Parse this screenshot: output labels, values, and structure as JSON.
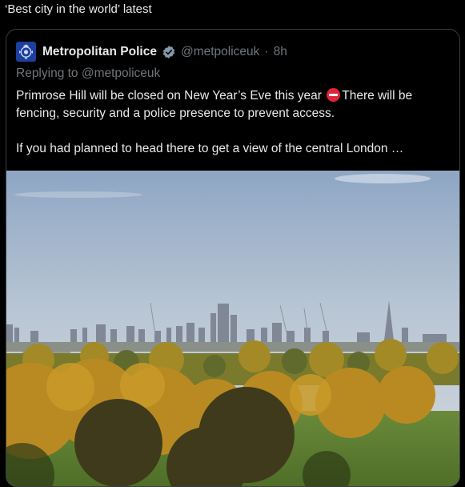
{
  "header": {
    "text": "‘Best city in the world’ latest"
  },
  "tweet": {
    "avatar_icon": "metropolitan-police-crest-icon",
    "display_name": "Metropolitan Police",
    "verified_icon": "verified-badge-icon",
    "handle": "@metpoliceuk",
    "separator": "·",
    "time": "8h",
    "reply_line": "Replying to @metpoliceuk",
    "text_part1": "Primrose Hill will be closed on New Year’s Eve this year ",
    "emoji_icon": "no-entry-emoji-icon",
    "text_part2": "There will be fencing, security and a police presence to prevent access.",
    "text_part3": "If you had planned to head there to get a view of the central London …",
    "image_subject": "london-skyline-from-primrose-hill-photo",
    "colors": {
      "background": "#000000",
      "text": "#e7e9ea",
      "muted": "#71767b",
      "verified": "#829aab",
      "card_border": "#3a3f44",
      "avatar_bg": "#1d3f9e"
    }
  }
}
